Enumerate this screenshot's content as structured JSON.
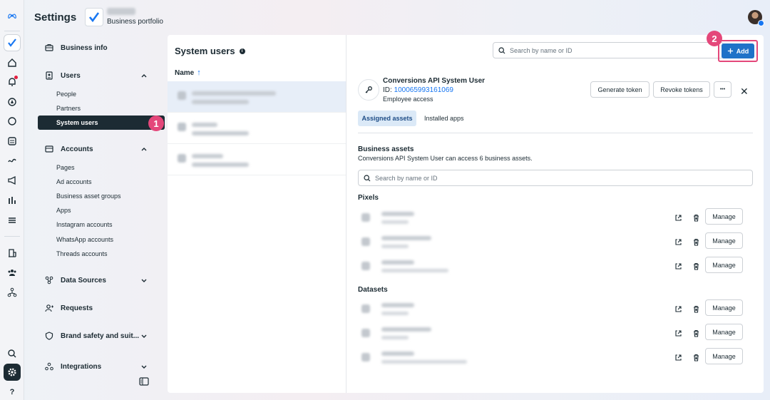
{
  "header": {
    "title": "Settings",
    "portfolio_label": "Business portfolio"
  },
  "sidebar": {
    "business_info": "Business info",
    "users": {
      "label": "Users",
      "items": [
        "People",
        "Partners",
        "System users"
      ]
    },
    "accounts": {
      "label": "Accounts",
      "items": [
        "Pages",
        "Ad accounts",
        "Business asset groups",
        "Apps",
        "Instagram accounts",
        "WhatsApp accounts",
        "Threads accounts"
      ]
    },
    "data_sources": "Data Sources",
    "requests": "Requests",
    "brand_safety": "Brand safety and suit...",
    "integrations": "Integrations",
    "active_item": "System users"
  },
  "steps": {
    "one": "1",
    "two": "2"
  },
  "main": {
    "title": "System users",
    "info_glyph": "i",
    "column_name": "Name",
    "sort_glyph": "↑",
    "search_placeholder": "Search by name or ID",
    "add_label": "Add"
  },
  "detail": {
    "name": "Conversions API System User",
    "id_prefix": "ID: ",
    "id_value": "100065993161069",
    "access": "Employee access",
    "generate_token": "Generate token",
    "revoke_tokens": "Revoke tokens",
    "more_glyph": "•••",
    "close_glyph": "✕",
    "tabs": [
      "Assigned assets",
      "Installed apps"
    ],
    "business_assets_title": "Business assets",
    "business_assets_desc": "Conversions API System User can access 6 business assets.",
    "asset_search_placeholder": "Search by name or ID",
    "groups": [
      {
        "title": "Pixels",
        "manage": [
          "Manage",
          "Manage",
          "Manage"
        ]
      },
      {
        "title": "Datasets",
        "manage": [
          "Manage",
          "Manage",
          "Manage"
        ]
      }
    ]
  },
  "colors": {
    "accent_blue": "#1f72c8",
    "step_badge_pink": "#e4477a",
    "active_nav_dark": "#1c2b33",
    "selected_tab_bg": "#dbe9f7"
  }
}
